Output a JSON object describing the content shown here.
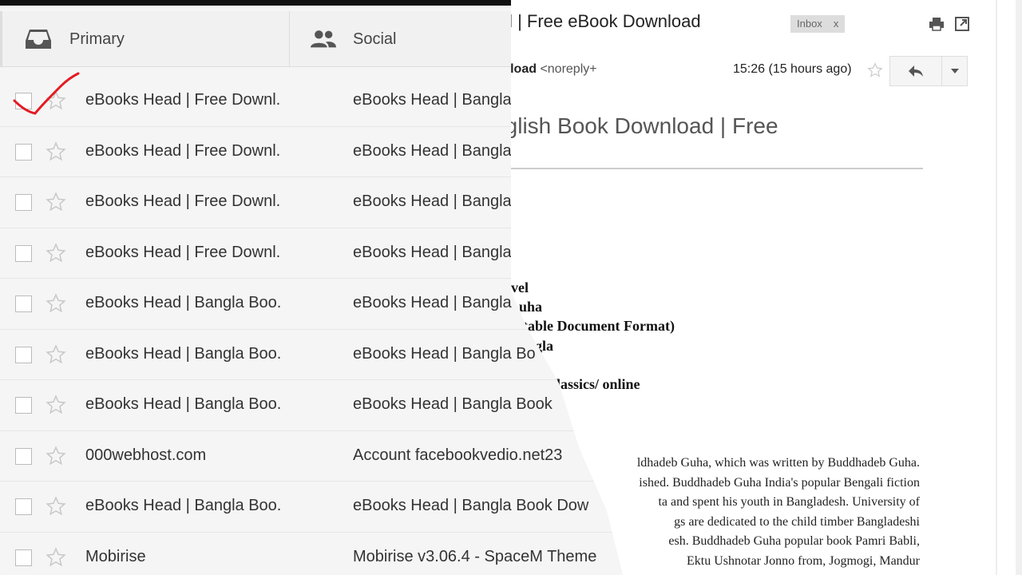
{
  "email": {
    "subject": "ownload | Free eBook Download",
    "label": "Inbox",
    "label_close": "x",
    "sender_name": "FDF Download",
    "sender_address": "<noreply+",
    "time": "15:26 (15 hours ago)",
    "heading": "d | English Book Download | Free",
    "doc_bold_lines": [
      "vel",
      "uha",
      "table Document Format)",
      "gla",
      "Classics/ online"
    ],
    "paragraph_lines": [
      "ldhadeb Guha, which was written by Buddhadeb Guha.",
      "ished. Buddhadeb Guha India's popular Bengali fiction",
      "ta and spent his youth in Bangladesh. University of",
      "gs are dedicated to the child timber Bangladeshi",
      "esh. Buddhadeb Guha popular book Pamri Babli,",
      "Ektu Ushnotar Jonno from, Jogmogi, Mandur"
    ],
    "icons": {
      "print": "print-icon",
      "newwindow": "new-window-icon",
      "reply": "reply-icon",
      "more": "chevron-down-icon",
      "star": "star-icon"
    }
  },
  "inbox": {
    "tabs": [
      {
        "label": "Primary",
        "icon": "inbox-icon"
      },
      {
        "label": "Social",
        "icon": "people-icon"
      }
    ],
    "rows": [
      {
        "sender": "eBooks Head | Free Downl.",
        "subject": "eBooks Head | Bangla",
        "checked": true
      },
      {
        "sender": "eBooks Head | Free Downl.",
        "subject": "eBooks Head | Bangla"
      },
      {
        "sender": "eBooks Head | Free Downl.",
        "subject": "eBooks Head | Bangla"
      },
      {
        "sender": "eBooks Head | Free Downl.",
        "subject": "eBooks Head | Bangla"
      },
      {
        "sender": "eBooks Head | Bangla Boo.",
        "subject": "eBooks Head | Bangla"
      },
      {
        "sender": "eBooks Head | Bangla Boo.",
        "subject": "eBooks Head | Bangla Bo"
      },
      {
        "sender": "eBooks Head | Bangla Boo.",
        "subject": "eBooks Head | Bangla Book"
      },
      {
        "sender": "000webhost.com",
        "subject": "Account facebookvedio.net23"
      },
      {
        "sender": "eBooks Head | Bangla Boo.",
        "subject": "eBooks Head | Bangla Book Dow"
      },
      {
        "sender": "Mobirise",
        "subject": "Mobirise v3.06.4 - SpaceM Theme"
      }
    ]
  }
}
